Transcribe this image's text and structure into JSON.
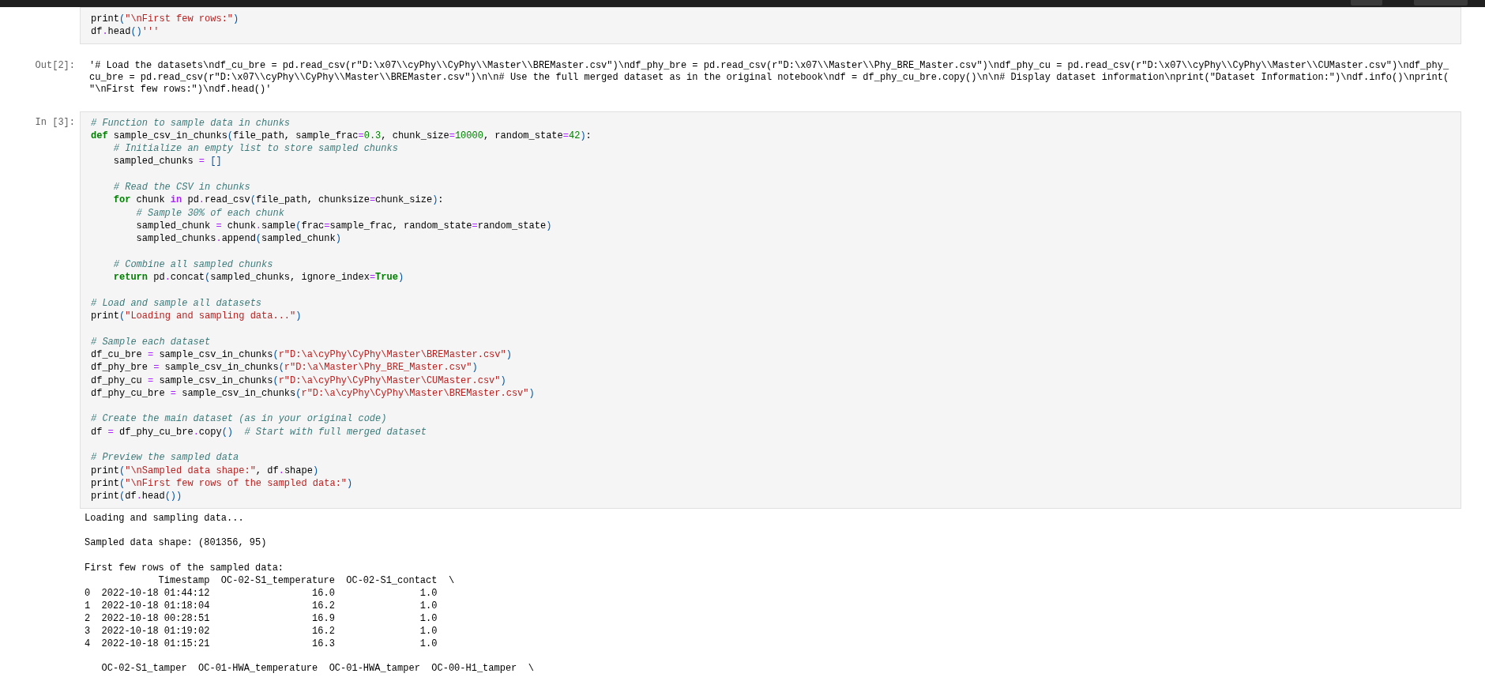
{
  "cells": [
    {
      "kind": "code",
      "blocks": [
        [
          [
            "print",
            {
              "kind": "bracket",
              "text": "("
            },
            {
              "kind": "string",
              "text": "\"\\nFirst few rows:\""
            },
            {
              "kind": "bracket",
              "text": ")"
            }
          ],
          [
            "df",
            {
              "kind": "operator",
              "text": "."
            },
            "head",
            {
              "kind": "bracket",
              "text": "()"
            },
            {
              "kind": "string",
              "text": "'''"
            }
          ]
        ]
      ]
    },
    {
      "kind": "result",
      "prompt": "Out[2]:",
      "text": "'# Load the datasets\\ndf_cu_bre = pd.read_csv(r\"D:\\x07\\\\cyPhy\\\\CyPhy\\\\Master\\\\BREMaster.csv\")\\ndf_phy_bre = pd.read_csv(r\"D:\\x07\\\\Master\\\\Phy_BRE_Master.csv\")\\ndf_phy_cu = pd.read_csv(r\"D:\\x07\\\\cyPhy\\\\CyPhy\\\\Master\\\\CUMaster.csv\")\\ndf_phy_cu_bre = pd.read_csv(r\"D:\\x07\\\\cyPhy\\\\CyPhy\\\\Master\\\\BREMaster.csv\")\\n\\n# Use the full merged dataset as in the original notebook\\ndf = df_phy_cu_bre.copy()\\n\\n# Display dataset information\\nprint(\"Dataset Information:\")\\ndf.info()\\nprint(\"\\nFirst few rows:\")\\ndf.head()'"
    },
    {
      "kind": "code",
      "prompt": "In [3]:",
      "blocks": [
        [
          [
            {
              "kind": "comment",
              "text": "# Function to sample data in chunks"
            }
          ],
          [
            {
              "kind": "keyword",
              "text": "def"
            },
            " sample_csv_in_chunks",
            {
              "kind": "bracket",
              "text": "("
            },
            "file_path, sample_frac",
            {
              "kind": "operator",
              "text": "="
            },
            {
              "kind": "number",
              "text": "0.3"
            },
            ", chunk_size",
            {
              "kind": "operator",
              "text": "="
            },
            {
              "kind": "number",
              "text": "10000"
            },
            ", random_state",
            {
              "kind": "operator",
              "text": "="
            },
            {
              "kind": "number",
              "text": "42"
            },
            {
              "kind": "bracket",
              "text": ")"
            },
            ":"
          ],
          [
            {
              "kind": "comment",
              "text": "    # Initialize an empty list to store sampled chunks"
            }
          ],
          [
            "    sampled_chunks ",
            {
              "kind": "operator",
              "text": "="
            },
            {
              "kind": "bracket",
              "text": " []"
            }
          ]
        ],
        [
          [
            {
              "kind": "comment",
              "text": "    # Read the CSV in chunks"
            }
          ],
          [
            {
              "kind": "keyword",
              "text": "    for"
            },
            " chunk ",
            {
              "kind": "opword",
              "text": "in"
            },
            " pd",
            {
              "kind": "operator",
              "text": "."
            },
            "read_csv",
            {
              "kind": "bracket",
              "text": "("
            },
            "file_path, chunksize",
            {
              "kind": "operator",
              "text": "="
            },
            "chunk_size",
            {
              "kind": "bracket",
              "text": ")"
            },
            ":"
          ],
          [
            {
              "kind": "comment",
              "text": "        # Sample 30% of each chunk"
            }
          ],
          [
            "        sampled_chunk ",
            {
              "kind": "operator",
              "text": "="
            },
            " chunk",
            {
              "kind": "operator",
              "text": "."
            },
            "sample",
            {
              "kind": "bracket",
              "text": "("
            },
            "frac",
            {
              "kind": "operator",
              "text": "="
            },
            "sample_frac, random_state",
            {
              "kind": "operator",
              "text": "="
            },
            "random_state",
            {
              "kind": "bracket",
              "text": ")"
            }
          ],
          [
            "        sampled_chunks",
            {
              "kind": "operator",
              "text": "."
            },
            "append",
            {
              "kind": "bracket",
              "text": "("
            },
            "sampled_chunk",
            {
              "kind": "bracket",
              "text": ")"
            }
          ]
        ],
        [
          [
            {
              "kind": "comment",
              "text": "    # Combine all sampled chunks"
            }
          ],
          [
            {
              "kind": "keyword",
              "text": "    return"
            },
            " pd",
            {
              "kind": "operator",
              "text": "."
            },
            "concat",
            {
              "kind": "bracket",
              "text": "("
            },
            "sampled_chunks, ignore_index",
            {
              "kind": "operator",
              "text": "="
            },
            {
              "kind": "keyword",
              "text": "True"
            },
            {
              "kind": "bracket",
              "text": ")"
            }
          ]
        ],
        [
          [
            {
              "kind": "comment",
              "text": "# Load and sample all datasets"
            }
          ],
          [
            "print",
            {
              "kind": "bracket",
              "text": "("
            },
            {
              "kind": "string",
              "text": "\"Loading and sampling data...\""
            },
            {
              "kind": "bracket",
              "text": ")"
            }
          ]
        ],
        [
          [
            {
              "kind": "comment",
              "text": "# Sample each dataset"
            }
          ],
          [
            "df_cu_bre ",
            {
              "kind": "operator",
              "text": "="
            },
            " sample_csv_in_chunks",
            {
              "kind": "bracket",
              "text": "("
            },
            {
              "kind": "string",
              "text": "r\"D:\\a\\cyPhy\\CyPhy\\Master\\BREMaster.csv\""
            },
            {
              "kind": "bracket",
              "text": ")"
            }
          ],
          [
            "df_phy_bre ",
            {
              "kind": "operator",
              "text": "="
            },
            " sample_csv_in_chunks",
            {
              "kind": "bracket",
              "text": "("
            },
            {
              "kind": "string",
              "text": "r\"D:\\a\\Master\\Phy_BRE_Master.csv\""
            },
            {
              "kind": "bracket",
              "text": ")"
            }
          ],
          [
            "df_phy_cu ",
            {
              "kind": "operator",
              "text": "="
            },
            " sample_csv_in_chunks",
            {
              "kind": "bracket",
              "text": "("
            },
            {
              "kind": "string",
              "text": "r\"D:\\a\\cyPhy\\CyPhy\\Master\\CUMaster.csv\""
            },
            {
              "kind": "bracket",
              "text": ")"
            }
          ],
          [
            "df_phy_cu_bre ",
            {
              "kind": "operator",
              "text": "="
            },
            " sample_csv_in_chunks",
            {
              "kind": "bracket",
              "text": "("
            },
            {
              "kind": "string",
              "text": "r\"D:\\a\\cyPhy\\CyPhy\\Master\\BREMaster.csv\""
            },
            {
              "kind": "bracket",
              "text": ")"
            }
          ]
        ],
        [
          [
            {
              "kind": "comment",
              "text": "# Create the main dataset (as in your original code)"
            }
          ],
          [
            "df ",
            {
              "kind": "operator",
              "text": "="
            },
            " df_phy_cu_bre",
            {
              "kind": "operator",
              "text": "."
            },
            "copy",
            {
              "kind": "bracket",
              "text": "()"
            },
            {
              "kind": "comment",
              "text": "  # Start with full merged dataset"
            }
          ]
        ],
        [
          [
            {
              "kind": "comment",
              "text": "# Preview the sampled data"
            }
          ],
          [
            "print",
            {
              "kind": "bracket",
              "text": "("
            },
            {
              "kind": "string",
              "text": "\"\\nSampled data shape:\""
            },
            ", df",
            {
              "kind": "operator",
              "text": "."
            },
            "shape",
            {
              "kind": "bracket",
              "text": ")"
            }
          ],
          [
            "print",
            {
              "kind": "bracket",
              "text": "("
            },
            {
              "kind": "string",
              "text": "\"\\nFirst few rows of the sampled data:\""
            },
            {
              "kind": "bracket",
              "text": ")"
            }
          ],
          [
            "print",
            {
              "kind": "bracket",
              "text": "("
            },
            "df",
            {
              "kind": "operator",
              "text": "."
            },
            "head",
            {
              "kind": "bracket",
              "text": "())"
            }
          ]
        ]
      ]
    },
    {
      "kind": "stream",
      "paragraphs": [
        [
          "Loading and sampling data..."
        ],
        [
          "Sampled data shape: (801356, 95)"
        ],
        [
          "First few rows of the sampled data:",
          "             Timestamp  OC-02-S1_temperature  OC-02-S1_contact  \\",
          "0  2022-10-18 01:44:12                  16.0               1.0",
          "1  2022-10-18 01:18:04                  16.2               1.0",
          "2  2022-10-18 00:28:51                  16.9               1.0",
          "3  2022-10-18 01:19:02                  16.2               1.0",
          "4  2022-10-18 01:15:21                  16.3               1.0"
        ],
        [
          "   OC-02-S1_tamper  OC-01-HWA_temperature  OC-01-HWA_tamper  OC-00-H1_tamper  \\"
        ]
      ]
    }
  ]
}
